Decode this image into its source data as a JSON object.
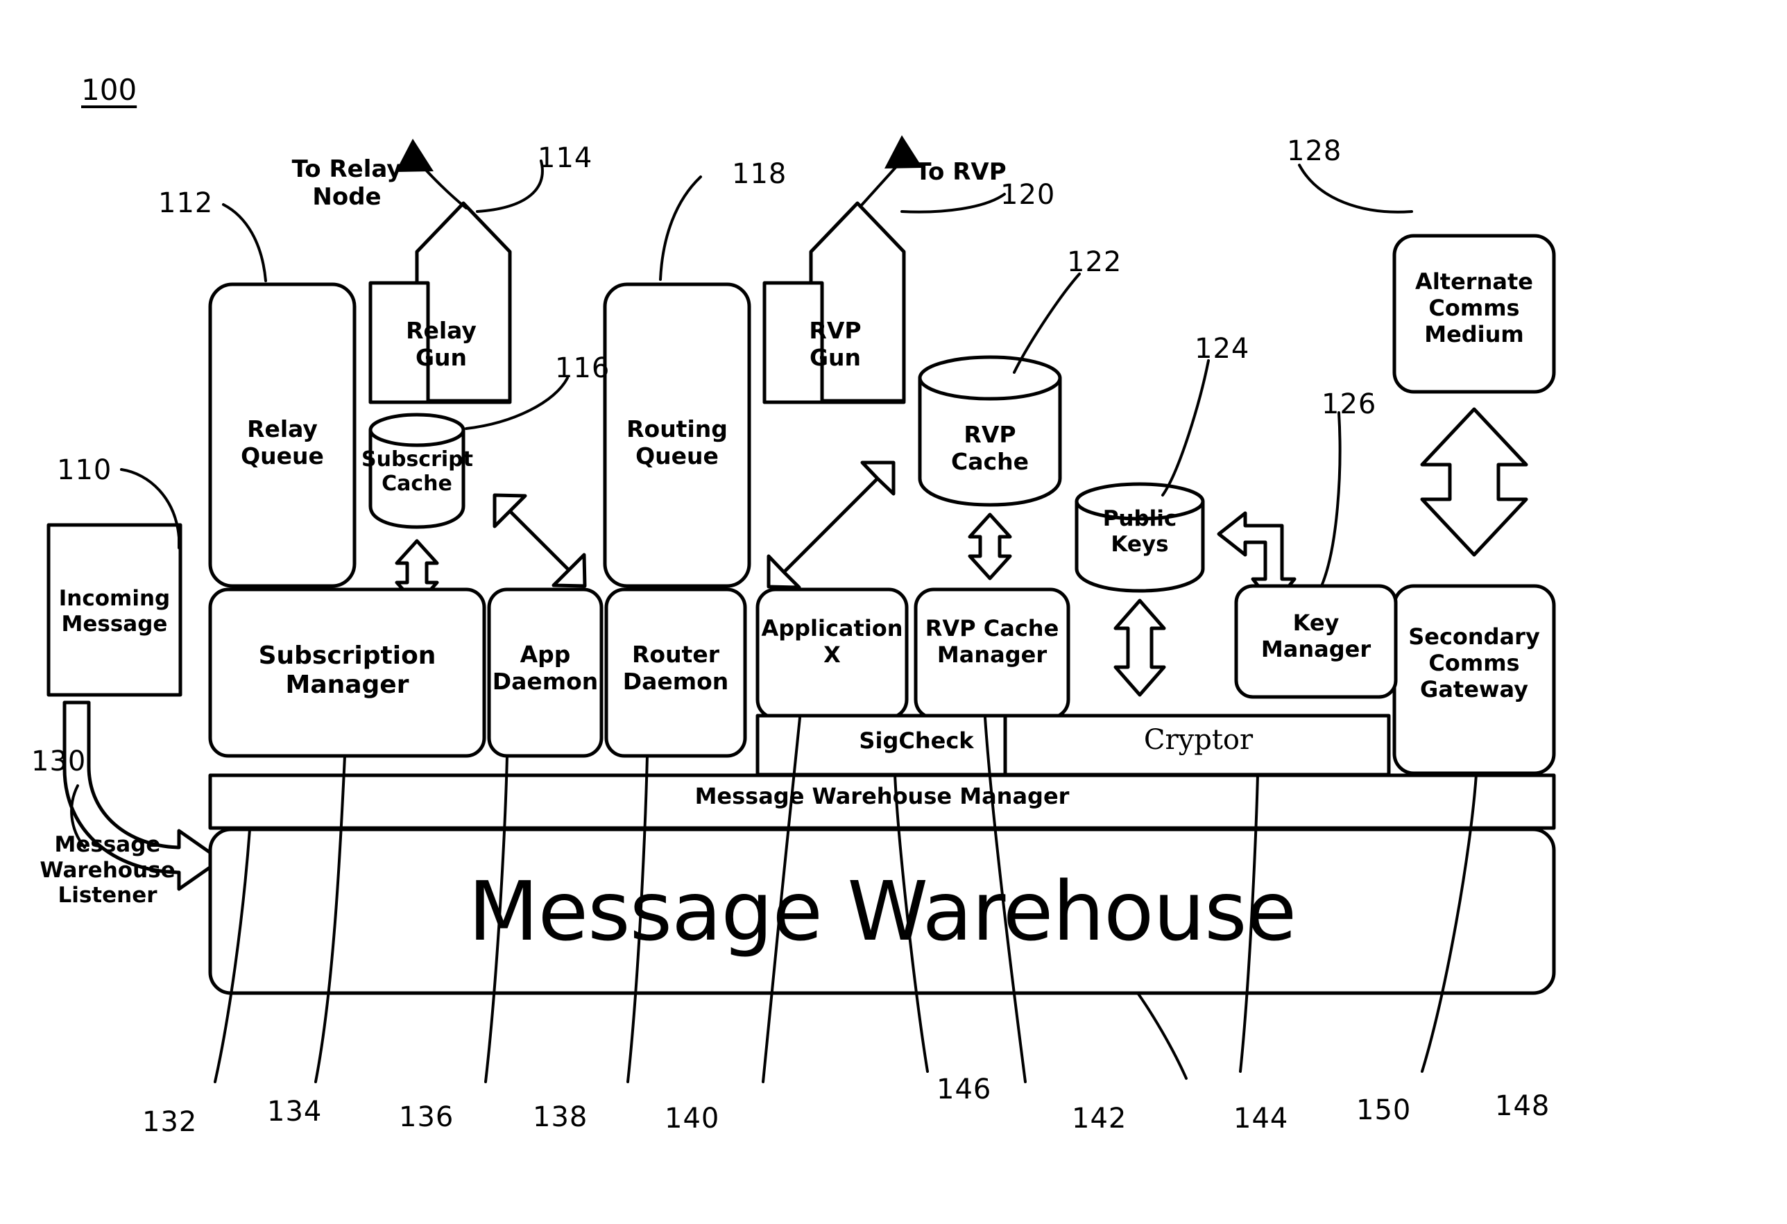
{
  "figure": {
    "number": "100",
    "domain": "patent-block-diagram"
  },
  "external_labels": {
    "to_relay_node": "To Relay Node",
    "to_rvp": "To RVP",
    "message_warehouse_listener": "Message\nWarehouse\nListener"
  },
  "blocks": {
    "incoming_message": {
      "label": "Incoming\nMessage",
      "ref": "110"
    },
    "relay_queue": {
      "label": "Relay\nQueue",
      "ref": "112"
    },
    "relay_gun": {
      "label": "Relay\nGun",
      "ref": "114"
    },
    "subscript_cache": {
      "label": "Subscript\nCache",
      "ref": "116"
    },
    "routing_queue": {
      "label": "Routing\nQueue",
      "ref": "118"
    },
    "rvp_gun": {
      "label": "RVP\nGun",
      "ref": "120"
    },
    "rvp_cache": {
      "label": "RVP\nCache",
      "ref": "122"
    },
    "public_keys": {
      "label": "Public\nKeys",
      "ref": "124"
    },
    "key_manager": {
      "label": "Key\nManager",
      "ref": "126"
    },
    "alternate_comms_medium": {
      "label": "Alternate\nComms\nMedium",
      "ref": "128"
    },
    "secondary_comms_gateway": {
      "label": "Secondary\nComms\nGateway",
      "ref": "148"
    },
    "subscription_manager": {
      "label": "Subscription\nManager",
      "ref": "134"
    },
    "app_daemon": {
      "label": "App\nDaemon",
      "ref": "136"
    },
    "router_daemon": {
      "label": "Router\nDaemon",
      "ref": "138"
    },
    "application_x": {
      "label": "Application\nX",
      "ref": "140"
    },
    "rvp_cache_manager": {
      "label": "RVP Cache\nManager",
      "ref": "142"
    },
    "sigcheck": {
      "label": "SigCheck",
      "ref": "146"
    },
    "cryptor": {
      "label": "Cryptor",
      "ref": "150"
    },
    "message_warehouse_manager": {
      "label": "Message Warehouse Manager",
      "ref": "132"
    },
    "message_warehouse": {
      "label": "Message Warehouse",
      "ref": "144"
    }
  },
  "reference_numerals": {
    "top": [
      "112",
      "114",
      "116",
      "118",
      "120",
      "122",
      "124",
      "126",
      "128"
    ],
    "left": [
      "110",
      "130"
    ],
    "bottom": [
      "132",
      "134",
      "136",
      "138",
      "140",
      "146",
      "142",
      "144",
      "150",
      "148"
    ]
  },
  "ref_values": {
    "n100": "100",
    "n110": "110",
    "n112": "112",
    "n114": "114",
    "n116": "116",
    "n118": "118",
    "n120": "120",
    "n122": "122",
    "n124": "124",
    "n126": "126",
    "n128": "128",
    "n130": "130",
    "n132": "132",
    "n134": "134",
    "n136": "136",
    "n138": "138",
    "n140": "140",
    "n142": "142",
    "n144": "144",
    "n146": "146",
    "n148": "148",
    "n150": "150"
  },
  "text_values": {
    "to_relay_node": "To Relay Node",
    "to_rvp": "To RVP",
    "incoming_message_l1": "Incoming",
    "incoming_message_l2": "Message",
    "mwl_l1": "Message",
    "mwl_l2": "Warehouse",
    "mwl_l3": "Listener",
    "relay_queue_l1": "Relay",
    "relay_queue_l2": "Queue",
    "relay_gun_l1": "Relay",
    "relay_gun_l2": "Gun",
    "subscript_cache_l1": "Subscript",
    "subscript_cache_l2": "Cache",
    "routing_queue_l1": "Routing",
    "routing_queue_l2": "Queue",
    "rvp_gun_l1": "RVP",
    "rvp_gun_l2": "Gun",
    "rvp_cache_l1": "RVP",
    "rvp_cache_l2": "Cache",
    "public_keys_l1": "Public",
    "public_keys_l2": "Keys",
    "key_manager_l1": "Key",
    "key_manager_l2": "Manager",
    "acm_l1": "Alternate",
    "acm_l2": "Comms",
    "acm_l3": "Medium",
    "scg_l1": "Secondary",
    "scg_l2": "Comms",
    "scg_l3": "Gateway",
    "sub_mgr_l1": "Subscription",
    "sub_mgr_l2": "Manager",
    "app_daemon_l1": "App",
    "app_daemon_l2": "Daemon",
    "router_daemon_l1": "Router",
    "router_daemon_l2": "Daemon",
    "app_x_l1": "Application",
    "app_x_l2": "X",
    "rvp_cm_l1": "RVP Cache",
    "rvp_cm_l2": "Manager",
    "sigcheck": "SigCheck",
    "cryptor": "Cryptor",
    "mwm": "Message Warehouse Manager",
    "mw": "Message Warehouse"
  },
  "colors": {
    "ink": "#000000",
    "paper": "#ffffff"
  }
}
